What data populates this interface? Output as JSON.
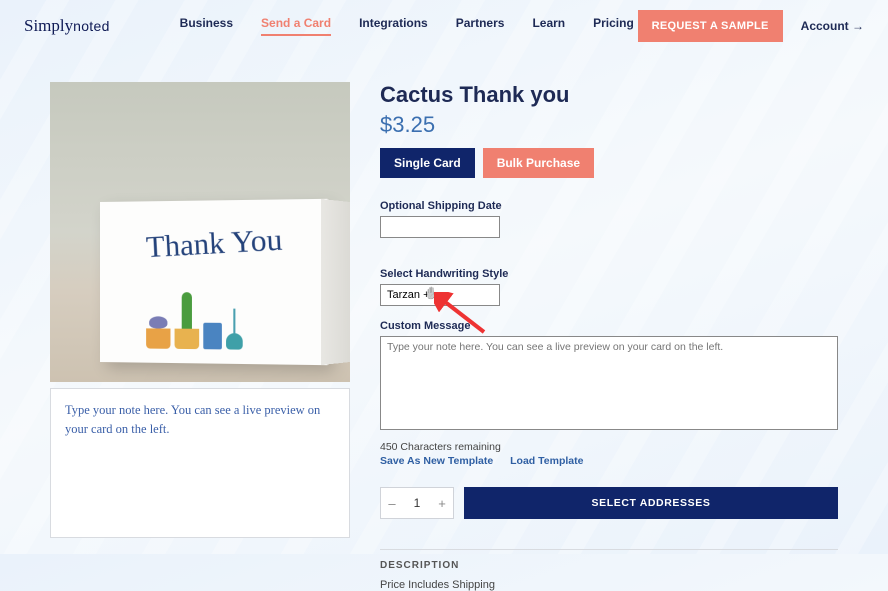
{
  "header": {
    "logo_script": "Simply",
    "logo_rest": "noted",
    "nav": {
      "business": "Business",
      "send_card": "Send a Card",
      "integrations": "Integrations",
      "partners": "Partners",
      "learn": "Learn",
      "pricing": "Pricing"
    },
    "request_sample": "REQUEST A SAMPLE",
    "account": "Account →"
  },
  "product": {
    "title": "Cactus Thank you",
    "price": "$3.25",
    "card_front_text": "Thank You",
    "single_label": "Single Card",
    "bulk_label": "Bulk Purchase"
  },
  "shipping": {
    "label": "Optional Shipping Date",
    "value": ""
  },
  "handwriting": {
    "label": "Select Handwriting Style",
    "value": "Tarzan +"
  },
  "message": {
    "label": "Custom Message",
    "placeholder": "Type your note here. You can see a live preview on your card on the left.",
    "remaining": "450 Characters remaining",
    "save_template": "Save As New Template",
    "load_template": "Load Template"
  },
  "preview": {
    "text": "Type your note here. You can see a live preview on your card on the left."
  },
  "qty": {
    "value": "1",
    "minus": "–",
    "plus": "+"
  },
  "actions": {
    "select_addresses": "SELECT ADDRESSES"
  },
  "description": {
    "heading": "DESCRIPTION",
    "line1": "Price Includes Shipping"
  }
}
